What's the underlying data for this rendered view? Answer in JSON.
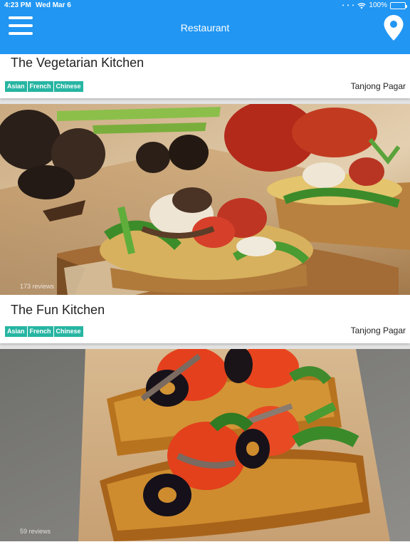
{
  "status_bar": {
    "time": "4:23 PM",
    "date": "Wed Mar 6",
    "battery": "100%",
    "battery_level": 1.0
  },
  "header": {
    "title": "Restaurant",
    "menu_icon": "hamburger-menu-icon",
    "location_icon": "map-pin-icon"
  },
  "restaurants": [
    {
      "name": "The Vegetarian Kitchen",
      "tags": [
        "Asian",
        "French",
        "Chinese"
      ],
      "area": "Tanjong Pagar"
    },
    {
      "name": "The Fun Kitchen",
      "reviews": "173 reviews",
      "tags": [
        "Asian",
        "French",
        "Chinese"
      ],
      "area": "Tanjong Pagar"
    },
    {
      "reviews": "59 reviews"
    }
  ],
  "colors": {
    "primary": "#2196f3",
    "tag": "#27b5a2"
  }
}
